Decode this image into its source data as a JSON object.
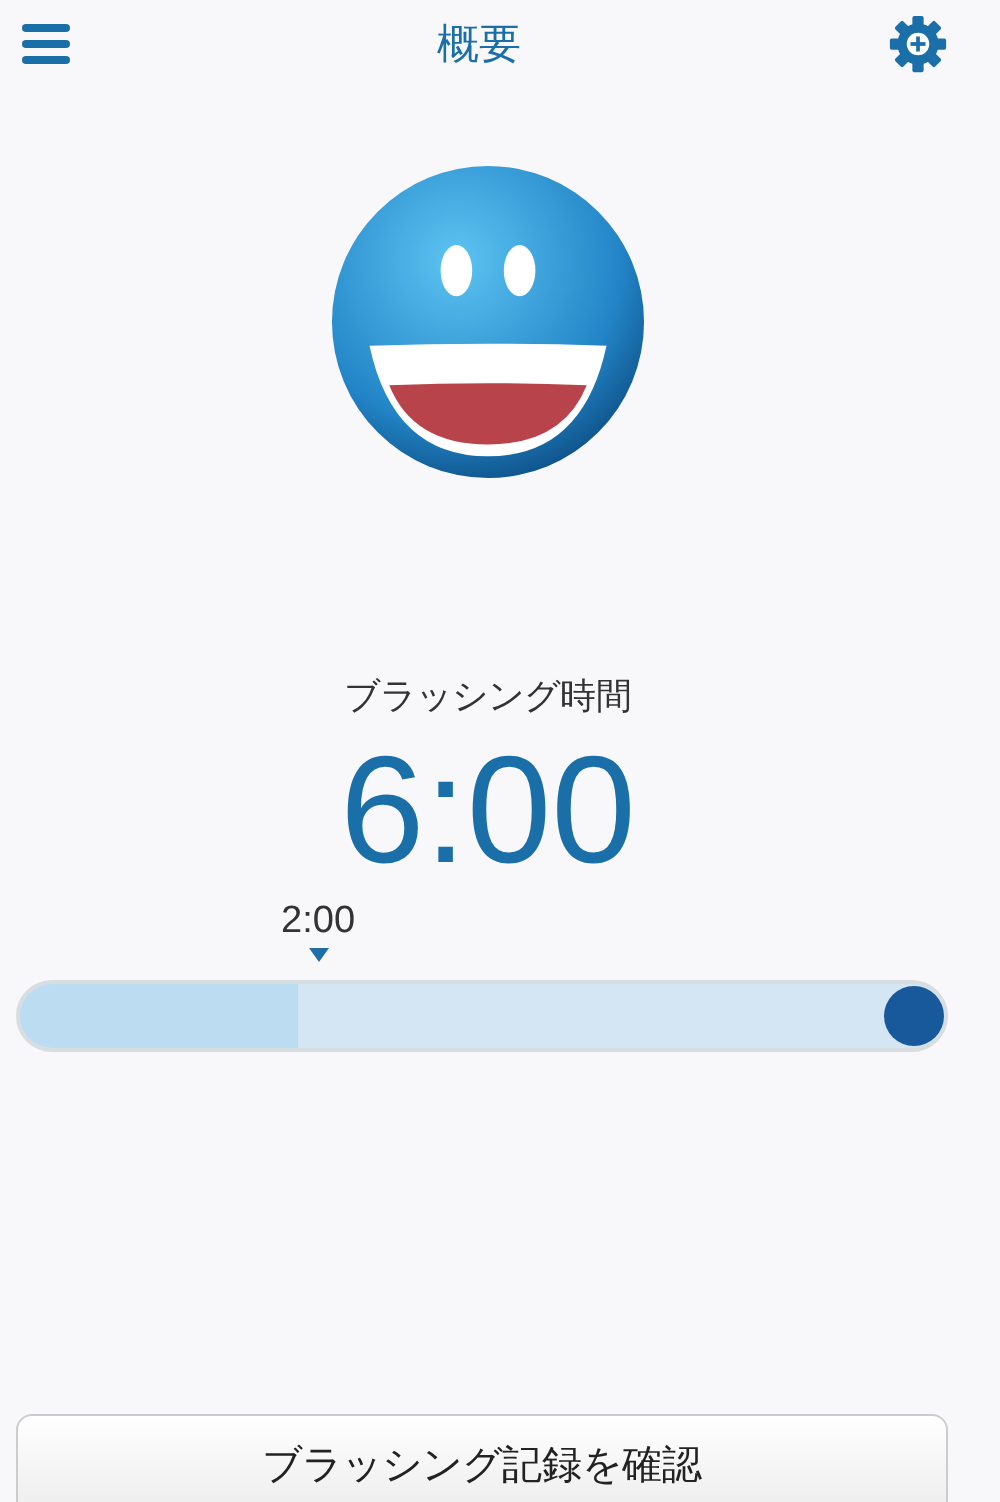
{
  "header": {
    "title": "概要"
  },
  "timer": {
    "label": "ブラッシング時間",
    "value": "6:00"
  },
  "slider": {
    "level": 1,
    "marker": {
      "label": "2:00"
    }
  },
  "buttons": [
    "ブラッシング記録を確認"
  ]
}
